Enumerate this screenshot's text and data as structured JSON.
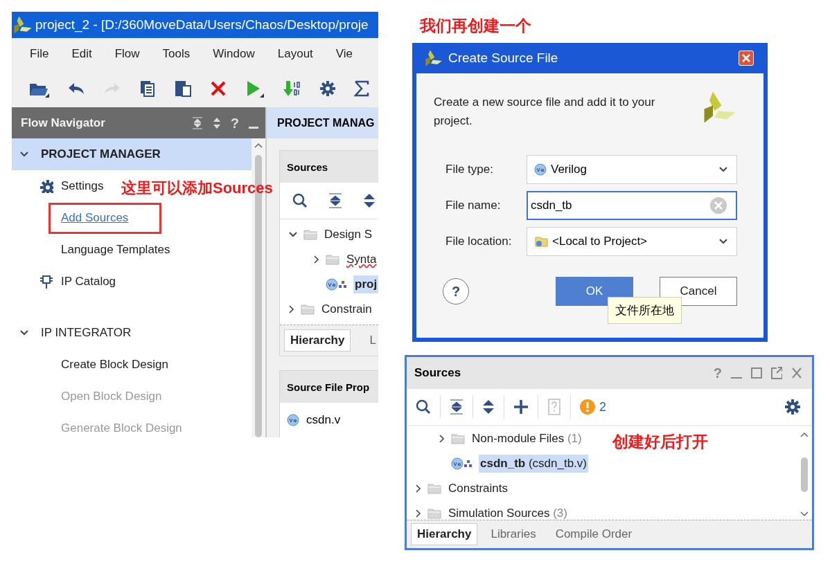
{
  "ide_window": {
    "title": "project_2 - [D:/360MoveData/Users/Chaos/Desktop/proje",
    "menu": [
      "File",
      "Edit",
      "Flow",
      "Tools",
      "Window",
      "Layout",
      "Vie"
    ],
    "toolbar": [
      {
        "kind": "open",
        "disabled": false
      },
      {
        "kind": "undo",
        "disabled": false
      },
      {
        "kind": "redo",
        "disabled": true
      },
      {
        "kind": "copy",
        "disabled": false
      },
      {
        "kind": "paste",
        "disabled": false
      },
      {
        "kind": "delete",
        "disabled": false
      },
      {
        "kind": "run",
        "disabled": false
      },
      {
        "kind": "bitstream",
        "disabled": false
      },
      {
        "kind": "settings",
        "disabled": false
      },
      {
        "kind": "sigma",
        "disabled": false
      }
    ],
    "flow_navigator": {
      "title": "Flow Navigator",
      "help_label": "?",
      "sections": [
        {
          "label": "PROJECT MANAGER",
          "expanded": true,
          "selected": true,
          "items": [
            {
              "label": "Settings",
              "kind": "settings",
              "hovered": false,
              "disabled": false
            },
            {
              "label": "Add Sources",
              "kind": "plain",
              "hovered": true,
              "disabled": false
            },
            {
              "label": "Language Templates",
              "kind": "plain",
              "hovered": false,
              "disabled": false
            },
            {
              "label": "IP Catalog",
              "kind": "catalog",
              "hovered": false,
              "disabled": false
            }
          ]
        },
        {
          "label": "IP INTEGRATOR",
          "expanded": true,
          "selected": false,
          "items": [
            {
              "label": "Create Block Design",
              "hovered": false,
              "disabled": false
            },
            {
              "label": "Open Block Design",
              "hovered": false,
              "disabled": true
            },
            {
              "label": "Generate Block Design",
              "hovered": false,
              "disabled": true
            }
          ]
        }
      ]
    },
    "project_manager": {
      "title": "PROJECT MANAG",
      "sources": {
        "title": "Sources",
        "tree": [
          {
            "label": "Design S",
            "expanded": true,
            "selected": false,
            "children": [
              {
                "label": "Synta",
                "expanded": false,
                "selected": false,
                "warning_underline": true
              },
              {
                "label": "proj",
                "kind": "module",
                "selected": true
              }
            ]
          },
          {
            "label": "Constrain",
            "expanded": false,
            "selected": false
          }
        ],
        "tabs": [
          {
            "label": "Hierarchy",
            "selected": true
          },
          {
            "label": "L",
            "selected": false
          }
        ]
      },
      "properties": {
        "title": "Source File Prop",
        "file": "csdn.v"
      }
    }
  },
  "dialog": {
    "title": "Create Source File",
    "description": "Create a new source file and add it to your project.",
    "help_label": "?",
    "fields": [
      {
        "label": "File type:",
        "kind": "type_dropdown",
        "value": "Verilog"
      },
      {
        "label": "File name:",
        "kind": "text",
        "value": "csdn_tb",
        "focused": true
      },
      {
        "label": "File location:",
        "kind": "location_dropdown",
        "value": "<Local to Project>"
      }
    ],
    "tooltip": "文件所在地",
    "buttons": [
      {
        "label": "OK",
        "primary": true
      },
      {
        "label": "Cancel",
        "primary": false
      }
    ]
  },
  "sources_panel": {
    "title": "Sources",
    "help_label": "?",
    "warning_count": "2",
    "tree": [
      {
        "children": [
          {
            "label": "Non-module Files",
            "count": "(1)",
            "expanded": false,
            "selected": false
          },
          {
            "label": "csdn_tb",
            "detail": "(csdn_tb.v)",
            "kind": "module",
            "selected": true
          }
        ]
      },
      {
        "label": "Constraints",
        "expanded": false,
        "selected": false
      },
      {
        "label": "Simulation Sources",
        "count": "(3)",
        "expanded": false,
        "selected": false
      }
    ],
    "tabs": [
      {
        "label": "Hierarchy",
        "selected": true
      },
      {
        "label": "Libraries",
        "selected": false
      },
      {
        "label": "Compile Order",
        "selected": false
      }
    ]
  },
  "annotations": [
    {
      "kind": "label",
      "text": "这里可以添加Sources"
    },
    {
      "kind": "frame"
    },
    {
      "kind": "label",
      "text": "我们再创建一个"
    },
    {
      "kind": "label",
      "text": "创建好后打开"
    }
  ]
}
